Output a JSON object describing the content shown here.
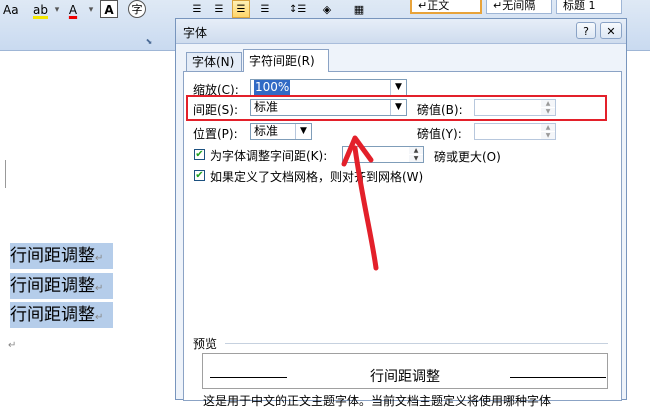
{
  "ribbon": {
    "font_size_btn": "Aa",
    "highlight_btn": "ab",
    "font_color_btn": "A",
    "char_border_btn": "A",
    "enclose_btn": "字",
    "styles": [
      {
        "label": "↵正文",
        "selected": true
      },
      {
        "label": "↵无间隔",
        "selected": false
      },
      {
        "label": "标题 1",
        "selected": false
      }
    ]
  },
  "document": {
    "lines": [
      "行间距调整",
      "行间距调整",
      "行间距调整"
    ],
    "paragraph_mark": "↵"
  },
  "dialog": {
    "title": "字体",
    "help": "?",
    "close": "✕",
    "tabs": [
      {
        "label": "字体(N)",
        "active": false
      },
      {
        "label": "字符间距(R)",
        "active": true
      }
    ],
    "scale": {
      "label": "缩放(C):",
      "value": "100%"
    },
    "spacing": {
      "label": "间距(S):",
      "value": "标准",
      "amount_label": "磅值(B):",
      "amount_value": ""
    },
    "position": {
      "label": "位置(P):",
      "value": "标准",
      "amount_label": "磅值(Y):",
      "amount_value": ""
    },
    "kerning": {
      "label": "为字体调整字间距(K):",
      "value": "",
      "suffix": "磅或更大(O)",
      "checked": true
    },
    "grid": {
      "label": "如果定义了文档网格，则对齐到网格(W)",
      "checked": true
    },
    "preview": {
      "label": "预览",
      "sample": "行间距调整",
      "description": "这是用于中文的正文主题字体。当前文档主题定义将使用哪种字体"
    }
  },
  "colors": {
    "annotation_red": "#e3202a",
    "selection_blue": "#b5cdea"
  }
}
